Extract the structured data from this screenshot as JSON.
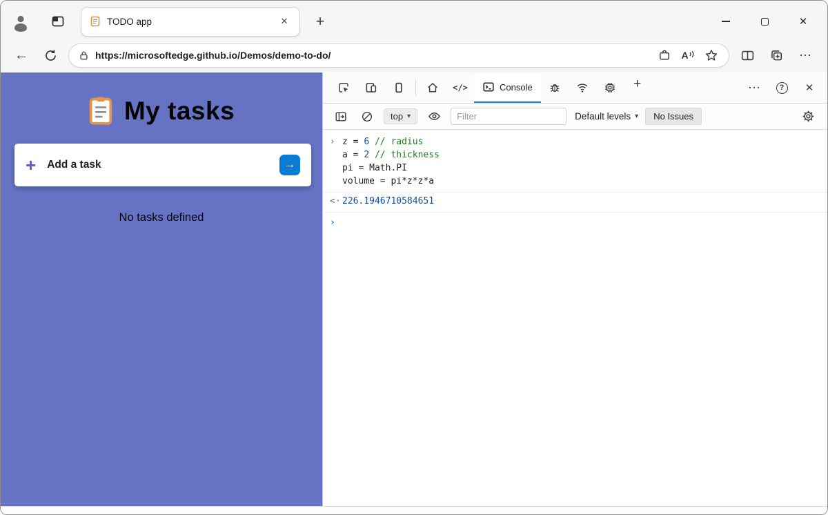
{
  "browser": {
    "tab_title": "TODO app",
    "url": "https://microsoftedge.github.io/Demos/demo-to-do/"
  },
  "icons": {
    "new_tab": "+",
    "close_tab": "✕",
    "minimize": "–",
    "close_window": "✕",
    "back": "←",
    "more_toolbar": "⋯",
    "more_devtools": "⋯",
    "sources_glyph": "</>",
    "caret_down": "▾",
    "help": "?",
    "close_devtools": "✕",
    "read_aloud_letter": "A",
    "add_plus": "+",
    "submit_arrow": "→",
    "input_chevron": "›",
    "result_marker": "<·",
    "prompt_chevron": "›"
  },
  "app": {
    "title": "My tasks",
    "add_task_label": "Add a task",
    "empty_message": "No tasks defined"
  },
  "devtools": {
    "console_tab_label": "Console",
    "toolbar": {
      "context_selector": "top",
      "filter_placeholder": "Filter",
      "levels_label": "Default levels",
      "issues_label": "No Issues"
    },
    "console": {
      "input_lines": [
        {
          "tokens": [
            {
              "text": "z = ",
              "type": "plain"
            },
            {
              "text": "6",
              "type": "number"
            },
            {
              "text": " ",
              "type": "plain"
            },
            {
              "text": "// radius",
              "type": "comment"
            }
          ]
        },
        {
          "tokens": [
            {
              "text": "a = ",
              "type": "plain"
            },
            {
              "text": "2",
              "type": "number"
            },
            {
              "text": " ",
              "type": "plain"
            },
            {
              "text": "// thickness",
              "type": "comment"
            }
          ]
        },
        {
          "tokens": [
            {
              "text": "pi = Math.PI",
              "type": "plain"
            }
          ]
        },
        {
          "tokens": [
            {
              "text": "volume = pi*z*z*a",
              "type": "plain"
            }
          ]
        }
      ],
      "result_value": "226.1946710584651"
    }
  },
  "colors": {
    "accent": "#0b7bd4",
    "app_background": "#6673c4",
    "number": "#1546c7",
    "comment": "#1e7d22",
    "result": "#0d4ea8"
  }
}
